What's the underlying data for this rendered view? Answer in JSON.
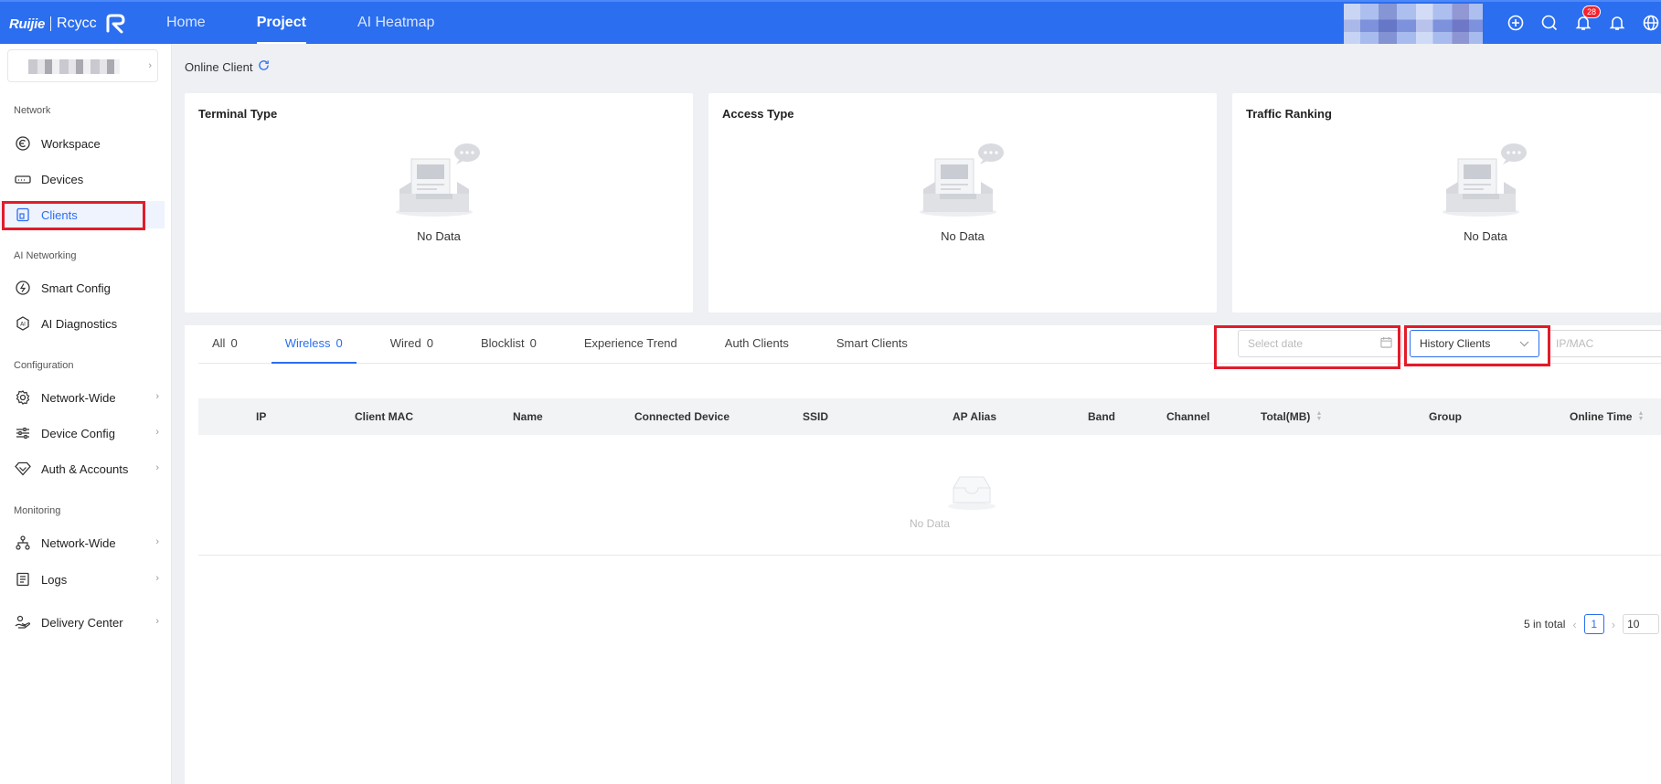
{
  "brand": {
    "logo": "Ruijie",
    "product": "Rcycc"
  },
  "nav": {
    "items": [
      "Home",
      "Project",
      "AI Heatmap"
    ],
    "active": "Project"
  },
  "header": {
    "notification_count": "28"
  },
  "sidebar": {
    "sections": {
      "network": "Network",
      "ai_networking": "AI Networking",
      "configuration": "Configuration",
      "monitoring": "Monitoring"
    },
    "items": {
      "workspace": "Workspace",
      "devices": "Devices",
      "clients": "Clients",
      "smart_config": "Smart Config",
      "ai_diagnostics": "AI Diagnostics",
      "network_wide_config": "Network-Wide",
      "device_config": "Device Config",
      "auth_accounts": "Auth & Accounts",
      "network_wide_monitor": "Network-Wide",
      "logs": "Logs",
      "delivery_center": "Delivery Center"
    },
    "active": "Clients"
  },
  "page": {
    "breadcrumb": "Online Client"
  },
  "cards": {
    "terminal_type": {
      "title": "Terminal Type",
      "empty": "No Data"
    },
    "access_type": {
      "title": "Access Type",
      "empty": "No Data"
    },
    "traffic_ranking": {
      "title": "Traffic Ranking",
      "empty": "No Data"
    }
  },
  "tabs": {
    "all": {
      "label": "All",
      "count": "0"
    },
    "wireless": {
      "label": "Wireless",
      "count": "0"
    },
    "wired": {
      "label": "Wired",
      "count": "0"
    },
    "blocklist": {
      "label": "Blocklist",
      "count": "0"
    },
    "experience_trend": {
      "label": "Experience Trend"
    },
    "auth_clients": {
      "label": "Auth Clients"
    },
    "smart_clients": {
      "label": "Smart Clients"
    },
    "active": "Wireless"
  },
  "filters": {
    "date_placeholder": "Select date",
    "client_type_value": "History Clients",
    "search_placeholder": "IP/MAC"
  },
  "table": {
    "columns": {
      "ip": "IP",
      "client_mac": "Client MAC",
      "name": "Name",
      "connected_device": "Connected Device",
      "ssid": "SSID",
      "ap_alias": "AP Alias",
      "band": "Band",
      "channel": "Channel",
      "total_mb": "Total(MB)",
      "group": "Group",
      "online_time": "Online Time"
    },
    "empty": "No Data"
  },
  "pagination": {
    "total": "5 in total",
    "current_page": "1",
    "page_size": "10"
  },
  "colors": {
    "primary": "#2b6ef0",
    "highlight": "#e31b2a",
    "badge": "#f5222d"
  }
}
